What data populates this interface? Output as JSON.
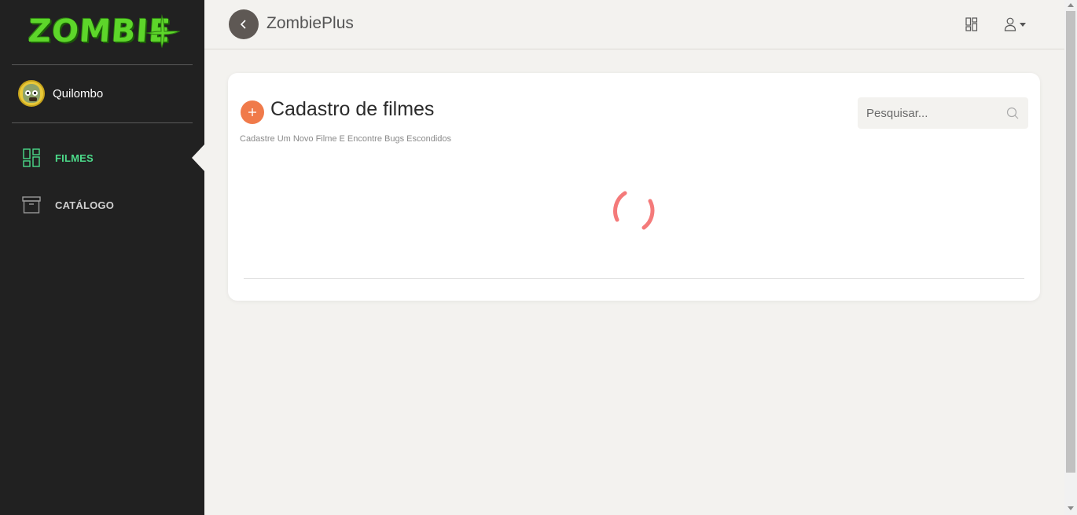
{
  "sidebar": {
    "logo_text": "ZOMBIE",
    "user": {
      "name": "Quilombo"
    },
    "nav": [
      {
        "label": "FILMES",
        "active": true,
        "icon": "dashboard-icon"
      },
      {
        "label": "CATÁLOGO",
        "active": false,
        "icon": "archive-box-icon"
      }
    ]
  },
  "header": {
    "title": "ZombiePlus"
  },
  "card": {
    "title": "Cadastro de filmes",
    "subtitle": "Cadastre Um Novo Filme E Encontre Bugs Escondidos",
    "search_placeholder": "Pesquisar..."
  },
  "colors": {
    "sidebar_bg": "#212121",
    "accent_green": "#4cdb8a",
    "add_button": "#f07a4a",
    "spinner": "#f47a7a",
    "page_bg": "#f3f2ef"
  }
}
